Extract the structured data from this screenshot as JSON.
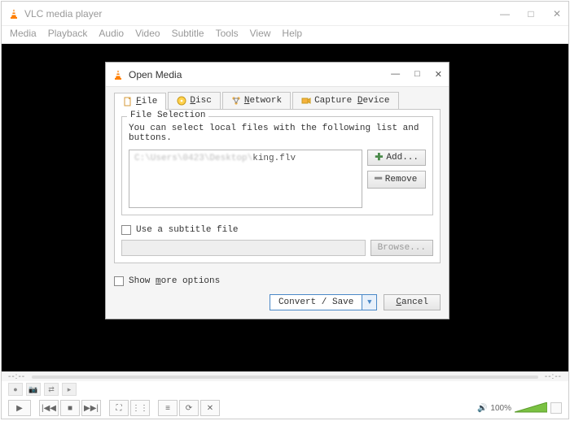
{
  "main": {
    "title": "VLC media player",
    "menu": [
      "Media",
      "Playback",
      "Audio",
      "Video",
      "Subtitle",
      "Tools",
      "View",
      "Help"
    ],
    "time_left": "--:--",
    "time_right": "--:--",
    "volume_pct": "100%"
  },
  "dialog": {
    "title": "Open Media",
    "tabs": {
      "file": {
        "pre": "",
        "u": "F",
        "post": "ile"
      },
      "disc": {
        "pre": "",
        "u": "D",
        "post": "isc"
      },
      "network": {
        "pre": "",
        "u": "N",
        "post": "etwork"
      },
      "capture": {
        "pre": "Capture ",
        "u": "D",
        "post": "evice"
      }
    },
    "file_selection": {
      "legend": "File Selection",
      "hint": "You can select local files with the following list and buttons.",
      "entry_prefix": "C:\\Users\\0423\\Desktop\\",
      "entry_name": "king.flv",
      "add_label": "Add...",
      "remove_label": "Remove"
    },
    "subtitle": {
      "label": "Use a subtitle file",
      "browse": "Browse..."
    },
    "more": {
      "pre": "Show ",
      "u": "m",
      "post": "ore options"
    },
    "convert_label": "Convert / Save",
    "cancel": {
      "u": "C",
      "post": "ancel"
    }
  }
}
